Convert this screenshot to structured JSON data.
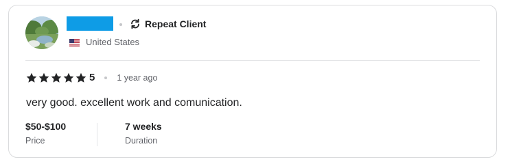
{
  "reviewer": {
    "badge_label": "Repeat Client",
    "country": "United States",
    "badge_icon": "repeat-icon",
    "flag_icon": "us-flag-icon",
    "name_mask_color": "#0e9ce6"
  },
  "rating": {
    "stars": 5,
    "score": "5",
    "time_ago": "1 year ago"
  },
  "review": {
    "text": "very good. excellent work and comunication."
  },
  "stats": {
    "price_value": "$50-$100",
    "price_label": "Price",
    "duration_value": "7 weeks",
    "duration_label": "Duration"
  }
}
